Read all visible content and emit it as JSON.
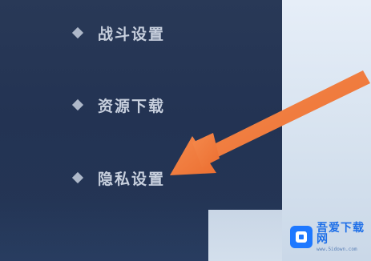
{
  "sidebar": {
    "items": [
      {
        "label": "战斗设置"
      },
      {
        "label": "资源下载"
      },
      {
        "label": "隐私设置"
      }
    ]
  },
  "annotation": {
    "arrow_color": "#f07a3c",
    "points_to": "隐私设置"
  },
  "watermark": {
    "title": "吾爱下载网",
    "url": "www.5idown.com",
    "logo_color": "#1e78ff"
  },
  "colors": {
    "sidebar_bg": "#243556",
    "menu_text": "#c7cfdd",
    "right_panel_bg": "#d9e4f1"
  }
}
